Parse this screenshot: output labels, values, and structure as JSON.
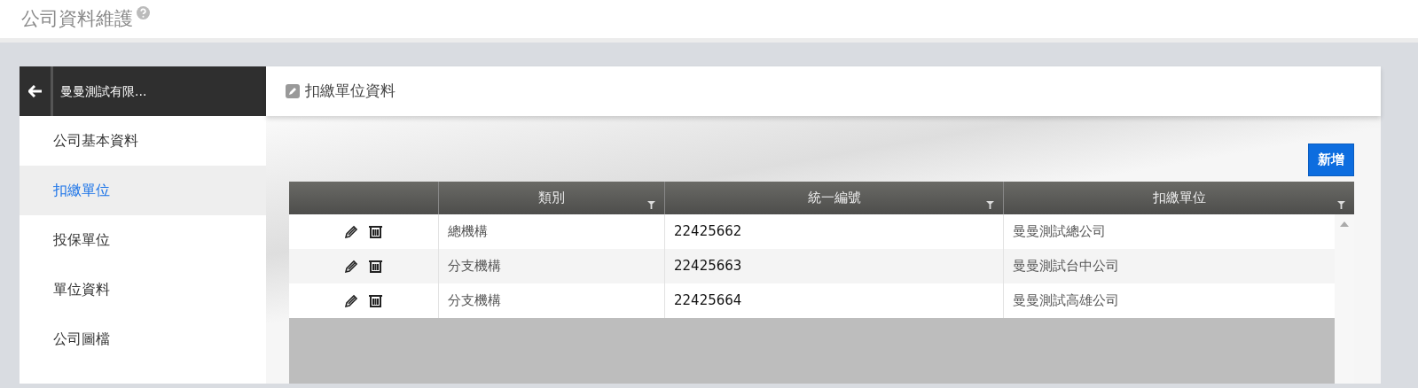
{
  "page": {
    "title": "公司資料維護"
  },
  "sidebar": {
    "company": "曼曼測試有限...",
    "items": [
      {
        "label": "公司基本資料",
        "selected": false
      },
      {
        "label": "扣繳單位",
        "selected": true
      },
      {
        "label": "投保單位",
        "selected": false
      },
      {
        "label": "單位資料",
        "selected": false
      },
      {
        "label": "公司圖檔",
        "selected": false
      }
    ]
  },
  "panel": {
    "title": "扣繳單位資料",
    "add_button": "新增"
  },
  "table": {
    "columns": [
      "類別",
      "統一編號",
      "扣繳單位"
    ],
    "rows": [
      {
        "cells": [
          "總機構",
          "22425662",
          "曼曼測試總公司"
        ]
      },
      {
        "cells": [
          "分支機構",
          "22425663",
          "曼曼測試台中公司"
        ]
      },
      {
        "cells": [
          "分支機構",
          "22425664",
          "曼曼測試高雄公司"
        ]
      }
    ]
  }
}
